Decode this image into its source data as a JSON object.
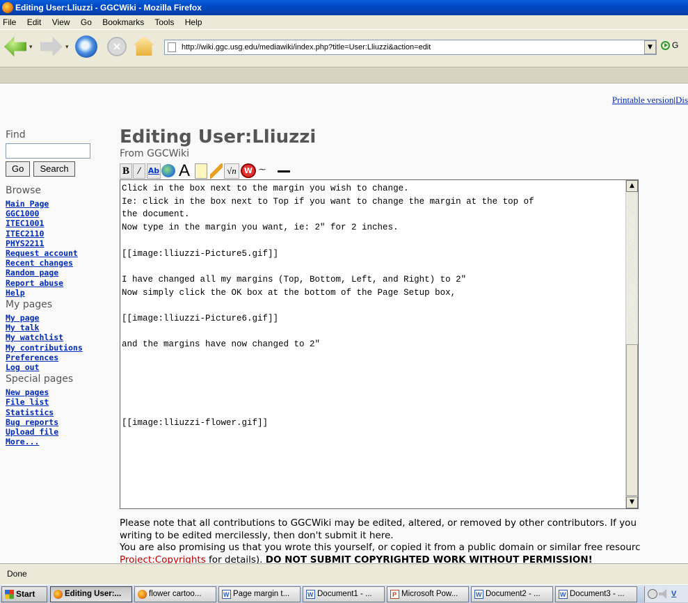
{
  "window": {
    "title": "Editing User:Lliuzzi - GGCWiki - Mozilla Firefox"
  },
  "menu": [
    "File",
    "Edit",
    "View",
    "Go",
    "Bookmarks",
    "Tools",
    "Help"
  ],
  "navbar": {
    "url": "http://wiki.ggc.usg.edu/mediawiki/index.php?title=User:Lliuzzi&action=edit",
    "go_label": "G"
  },
  "page": {
    "printable_label": "Printable version",
    "sep": "|",
    "disc_label": "Dis",
    "title": "Editing User:Lliuzzi",
    "subtitle": "From GGCWiki"
  },
  "sidebar": {
    "find_heading": "Find",
    "go_label": "Go",
    "search_label": "Search",
    "browse_heading": "Browse",
    "browse_items": [
      "Main Page",
      "GGC1000",
      "ITEC1001",
      "ITEC2110",
      "PHYS2211",
      "Request account",
      "Recent changes",
      "Random page",
      "Report abuse",
      "Help"
    ],
    "mypages_heading": "My pages",
    "mypages_items": [
      "My page",
      "My talk",
      "My watchlist",
      "My contributions",
      "Preferences",
      "Log out"
    ],
    "special_heading": "Special pages",
    "special_items": [
      "New pages",
      "File list",
      "Statistics",
      "Bug reports",
      "Upload file",
      "More..."
    ]
  },
  "editor": {
    "text": "Click in the box next to the margin you wish to change.\nIe: click in the box next to Top if you want to change the margin at the top of\nthe document.\nNow type in the margin you want, ie: 2″ for 2 inches.\n\n[[image:lliuzzi-Picture5.gif]]\n\nI have changed all my margins (Top, Bottom, Left, and Right) to 2″\nNow simply click the OK box at the bottom of the Page Setup box,\n\n[[image:lliuzzi-Picture6.gif]]\n\nand the margins have now changed to 2″\n\n\n\n\n\n[[image:lliuzzi-flower.gif]]"
  },
  "notice": {
    "line1": "Please note that all contributions to GGCWiki may be edited, altered, or removed by other contributors. If you",
    "line2": "writing to be edited mercilessly, then don't submit it here.",
    "line3": "You are also promising us that you wrote this yourself, or copied it from a public domain or similar free resourc",
    "link": "Project:Copyrights",
    "line4_mid": " for details). ",
    "line4_bold": "DO NOT SUBMIT COPYRIGHTED WORK WITHOUT PERMISSION!"
  },
  "status": "Done",
  "taskbar": {
    "start": "Start",
    "tasks": [
      "Editing User:...",
      "flower cartoo...",
      "Page margin t...",
      "Document1 - ...",
      "Microsoft Pow...",
      "Document2 - ...",
      "Document3 - ..."
    ],
    "tray_text": "V"
  }
}
